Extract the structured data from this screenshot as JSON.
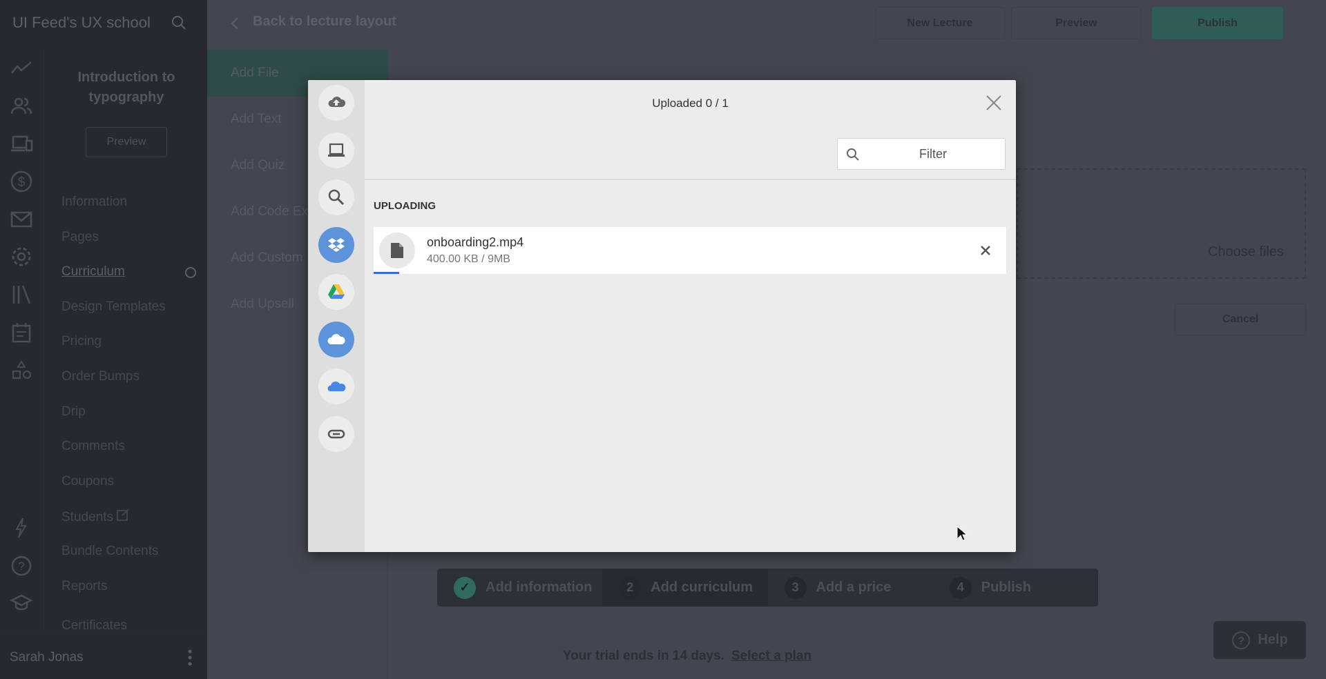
{
  "sidebar": {
    "brand": "UI Feed's UX school",
    "rail_icons": [
      "analytics-icon",
      "users-icon",
      "devices-icon",
      "dollar-icon",
      "mail-icon",
      "gear-icon",
      "library-icon",
      "calendar-icon",
      "shapes-icon",
      "lightning-icon",
      "help-circle-icon",
      "graduation-cap-icon"
    ],
    "course_title": "Introduction to typography",
    "preview_label": "Preview",
    "items": [
      {
        "label": "Information"
      },
      {
        "label": "Pages"
      },
      {
        "label": "Curriculum",
        "active": true
      },
      {
        "label": "Design Templates"
      },
      {
        "label": "Pricing"
      },
      {
        "label": "Order Bumps"
      },
      {
        "label": "Drip"
      },
      {
        "label": "Comments"
      },
      {
        "label": "Coupons"
      },
      {
        "label": "Students",
        "external": true
      },
      {
        "label": "Bundle Contents"
      },
      {
        "label": "Reports"
      },
      {
        "label": "Certificates"
      }
    ],
    "user": "Sarah Jonas"
  },
  "header": {
    "back_label": "Back to lecture layout",
    "new_lecture": "New Lecture",
    "preview": "Preview",
    "publish": "Publish"
  },
  "submenu": [
    "Add File",
    "Add Text",
    "Add Quiz",
    "Add Code Ex",
    "Add Custom",
    "Add Upsell"
  ],
  "dropzone": {
    "text": "Choose files"
  },
  "cancel_label": "Cancel",
  "stepper": [
    {
      "num": "✓",
      "label": "Add information",
      "done": true
    },
    {
      "num": "2",
      "label": "Add curriculum",
      "current": true
    },
    {
      "num": "3",
      "label": "Add a price"
    },
    {
      "num": "4",
      "label": "Publish"
    }
  ],
  "trial": {
    "text": "Your trial ends in 14 days.",
    "link": "Select a plan"
  },
  "help_label": "Help",
  "modal": {
    "title": "Uploaded 0 / 1",
    "sources": [
      "upload-cloud-icon",
      "my-device-icon",
      "web-search-icon",
      "dropbox-icon",
      "google-drive-icon",
      "cloud-app-icon",
      "onedrive-icon",
      "link-icon"
    ],
    "filter_placeholder": "Filter",
    "section": "UPLOADING",
    "file": {
      "name": "onboarding2.mp4",
      "size": "400.00 KB / 9MB",
      "progress_percent": 4
    },
    "colors": {
      "progress": "#3d64d8",
      "source_active": "#5d93db"
    }
  },
  "colors": {
    "accent": "#2f6b60"
  }
}
